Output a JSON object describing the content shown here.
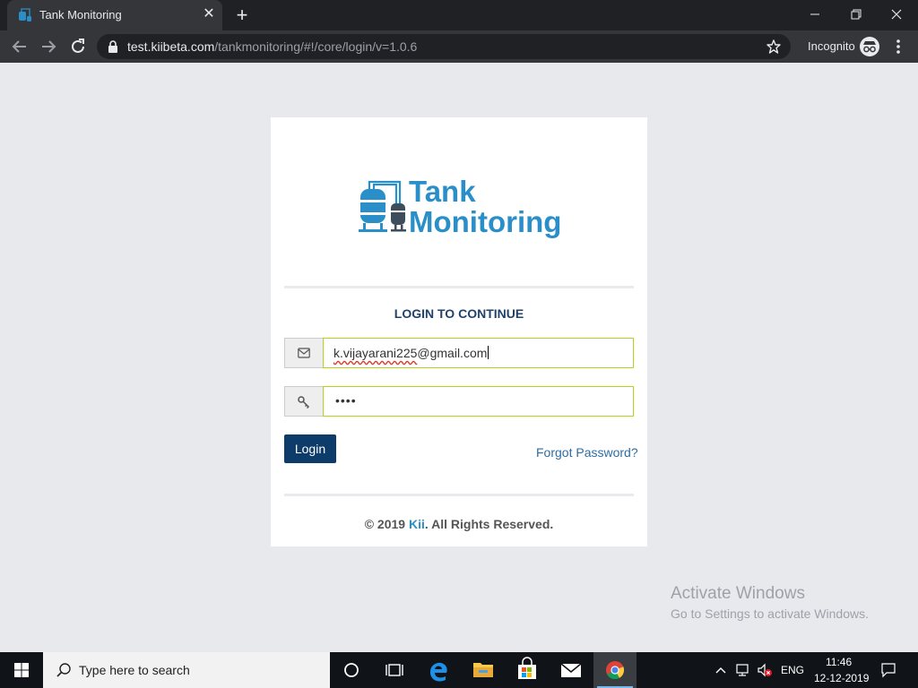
{
  "browser": {
    "tab_title": "Tank Monitoring",
    "url_host": "test.kiibeta.com",
    "url_path": "/tankmonitoring/#!/core/login/v=1.0.6",
    "incognito_label": "Incognito"
  },
  "logo": {
    "line1": "Tank",
    "line2": "Monitoring"
  },
  "login": {
    "heading": "LOGIN TO CONTINUE",
    "email_misspelled": "k.vijayarani225",
    "email_rest": "@gmail.com",
    "password_mask": "••••",
    "login_button": "Login",
    "forgot_password": "Forgot Password?",
    "copyright_prefix": "© 2019 ",
    "copyright_brand": "Kii",
    "copyright_suffix": ". All Rights Reserved."
  },
  "watermark": {
    "title": "Activate Windows",
    "subtitle": "Go to Settings to activate Windows."
  },
  "taskbar": {
    "search_placeholder": "Type here to search",
    "language": "ENG",
    "time": "11:46",
    "date": "12-12-2019"
  },
  "colors": {
    "brand_blue": "#2a8fc8",
    "login_button": "#0d3b6a",
    "field_border": "#b4d41a",
    "heading": "#21426b"
  },
  "icons": {
    "email_field": "envelope-icon",
    "password_field": "key-icon"
  }
}
